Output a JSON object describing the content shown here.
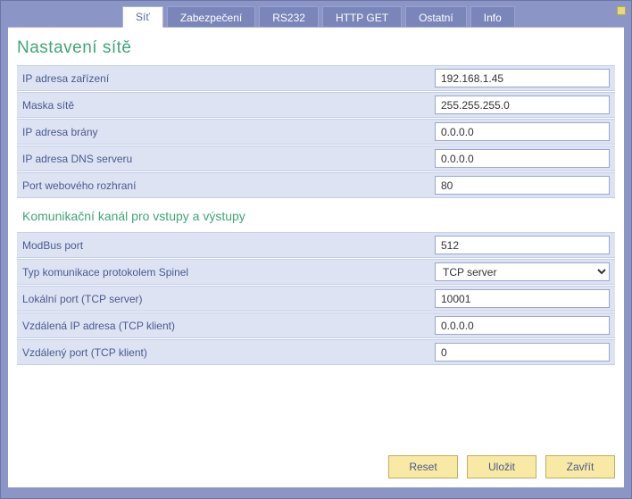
{
  "tabs": {
    "sit": "Síť",
    "zabezpeceni": "Zabezpečení",
    "rs232": "RS232",
    "httpget": "HTTP GET",
    "ostatni": "Ostatní",
    "info": "Info"
  },
  "section1": {
    "title": "Nastavení sítě",
    "ip_adresa_zarizeni": {
      "label": "IP adresa zařízení",
      "value": "192.168.1.45"
    },
    "maska_site": {
      "label": "Maska sítě",
      "value": "255.255.255.0"
    },
    "ip_adresa_brany": {
      "label": "IP adresa brány",
      "value": "0.0.0.0"
    },
    "ip_adresa_dns": {
      "label": "IP adresa DNS serveru",
      "value": "0.0.0.0"
    },
    "port_web": {
      "label": "Port webového rozhraní",
      "value": "80"
    }
  },
  "section2": {
    "title": "Komunikační kanál pro vstupy a výstupy",
    "modbus_port": {
      "label": "ModBus port",
      "value": "512"
    },
    "typ_komunikace": {
      "label": "Typ komunikace protokolem Spinel",
      "value": "TCP server"
    },
    "lokalni_port": {
      "label": "Lokální port (TCP server)",
      "value": "10001"
    },
    "vzdalena_ip": {
      "label": "Vzdálená IP adresa (TCP klient)",
      "value": "0.0.0.0"
    },
    "vzdaleny_port": {
      "label": "Vzdálený port (TCP klient)",
      "value": "0"
    }
  },
  "buttons": {
    "reset": "Reset",
    "ulozit": "Uložit",
    "zavrit": "Zavřít"
  }
}
